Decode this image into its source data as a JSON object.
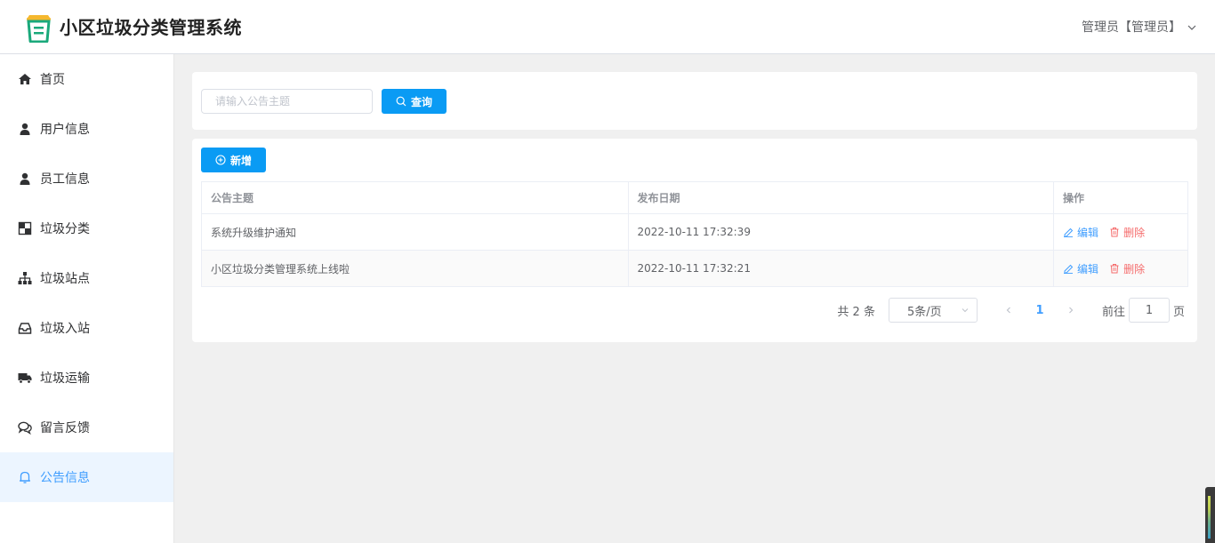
{
  "header": {
    "title": "小区垃圾分类管理系统",
    "user": "管理员【管理员】",
    "logo_icon": "trash-bin-logo",
    "logo_colors": {
      "lid": "#f5b82e",
      "bin": "#1aa97b"
    }
  },
  "sidebar": {
    "items": [
      {
        "label": "首页",
        "icon": "home-icon",
        "active": false
      },
      {
        "label": "用户信息",
        "icon": "user-icon",
        "active": false
      },
      {
        "label": "员工信息",
        "icon": "user-icon",
        "active": false
      },
      {
        "label": "垃圾分类",
        "icon": "grid-icon",
        "active": false
      },
      {
        "label": "垃圾站点",
        "icon": "sitemap-icon",
        "active": false
      },
      {
        "label": "垃圾入站",
        "icon": "inbox-icon",
        "active": false
      },
      {
        "label": "垃圾运输",
        "icon": "truck-icon",
        "active": false
      },
      {
        "label": "留言反馈",
        "icon": "chat-icon",
        "active": false
      },
      {
        "label": "公告信息",
        "icon": "bell-icon",
        "active": true
      }
    ]
  },
  "search": {
    "placeholder": "请输入公告主题",
    "button_label": "查询"
  },
  "toolbar": {
    "add_label": "新增"
  },
  "table": {
    "columns": [
      "公告主题",
      "发布日期",
      "操作"
    ],
    "rows": [
      {
        "title": "系统升级维护通知",
        "date": "2022-10-11 17:32:39"
      },
      {
        "title": "小区垃圾分类管理系统上线啦",
        "date": "2022-10-11 17:32:21"
      }
    ],
    "edit_label": "编辑",
    "delete_label": "删除"
  },
  "pagination": {
    "total": "共 2 条",
    "page_size": "5条/页",
    "current_page": "1",
    "goto_prefix": "前往",
    "goto_value": "1",
    "goto_suffix": "页"
  },
  "colors": {
    "primary": "#0a9bf4",
    "link": "#409eff",
    "danger": "#f56c6c",
    "active_bg": "#ecf5ff"
  }
}
